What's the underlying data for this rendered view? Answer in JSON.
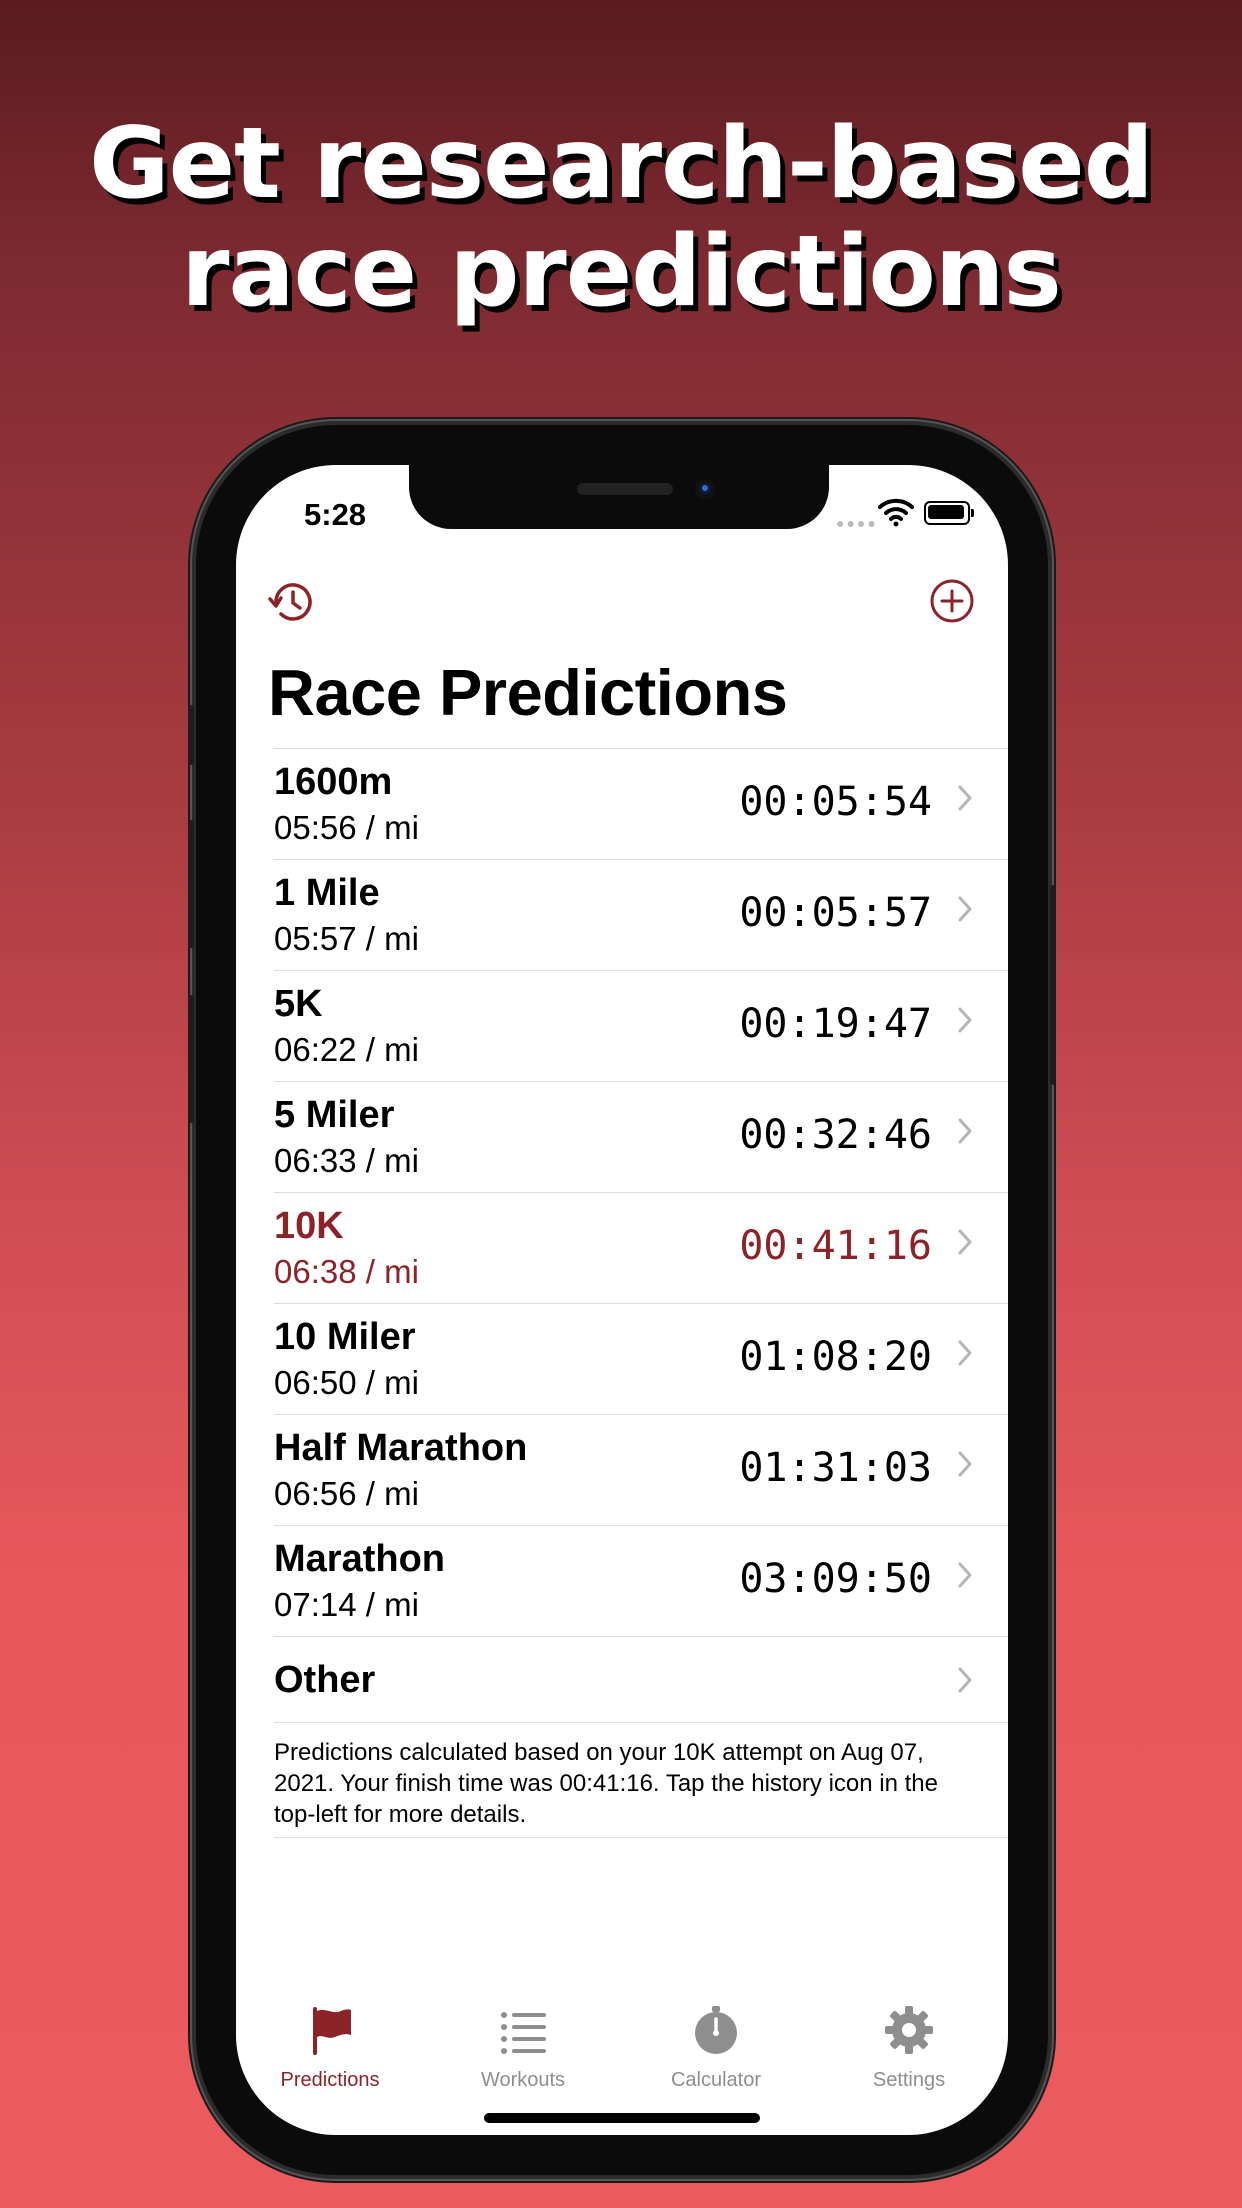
{
  "headline": {
    "line1": "Get research-based",
    "line2": "race predictions"
  },
  "status_bar": {
    "time": "5:28",
    "signal_icon": "signal-dots-icon",
    "wifi_icon": "wifi-icon",
    "battery_icon": "battery-icon"
  },
  "nav": {
    "left_icon": "history-icon",
    "right_icon": "plus-circle-icon",
    "title": "Race Predictions"
  },
  "accent_color": "#8c2328",
  "predictions": [
    {
      "name": "1600m",
      "pace": "05:56 / mi",
      "time": "00:05:54",
      "highlighted": false
    },
    {
      "name": "1 Mile",
      "pace": "05:57 / mi",
      "time": "00:05:57",
      "highlighted": false
    },
    {
      "name": "5K",
      "pace": "06:22 / mi",
      "time": "00:19:47",
      "highlighted": false
    },
    {
      "name": "5 Miler",
      "pace": "06:33 / mi",
      "time": "00:32:46",
      "highlighted": false
    },
    {
      "name": "10K",
      "pace": "06:38 / mi",
      "time": "00:41:16",
      "highlighted": true
    },
    {
      "name": "10 Miler",
      "pace": "06:50 / mi",
      "time": "01:08:20",
      "highlighted": false
    },
    {
      "name": "Half Marathon",
      "pace": "06:56 / mi",
      "time": "01:31:03",
      "highlighted": false
    },
    {
      "name": "Marathon",
      "pace": "07:14 / mi",
      "time": "03:09:50",
      "highlighted": false
    }
  ],
  "other": {
    "label": "Other"
  },
  "footnote": "Predictions calculated based on your 10K attempt on Aug 07, 2021. Your finish time was 00:41:16. Tap the history icon in the top-left for more details.",
  "tabs": [
    {
      "label": "Predictions",
      "icon": "flag-icon",
      "active": true
    },
    {
      "label": "Workouts",
      "icon": "list-icon",
      "active": false
    },
    {
      "label": "Calculator",
      "icon": "stopwatch-icon",
      "active": false
    },
    {
      "label": "Settings",
      "icon": "gear-icon",
      "active": false
    }
  ]
}
